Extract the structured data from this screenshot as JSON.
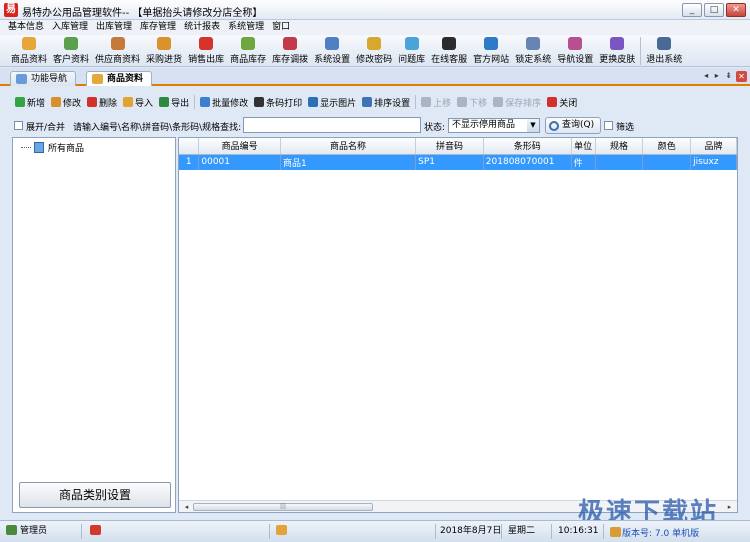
{
  "window": {
    "title": "易特办公用品管理软件-- 【单据抬头请修改分店全称】",
    "app_icon_glyph": "易",
    "minimize": "_",
    "restore": "□",
    "close": "✕"
  },
  "menu": [
    "基本信息",
    "入库管理",
    "出库管理",
    "库存管理",
    "统计报表",
    "系统管理",
    "窗口"
  ],
  "toolbar": [
    {
      "label": "商品资料",
      "icon": "box-icon",
      "color": "#e8a53a"
    },
    {
      "label": "客户资料",
      "icon": "users-icon",
      "color": "#5aa04e"
    },
    {
      "label": "供应商资料",
      "icon": "supplier-icon",
      "color": "#c57a3c"
    },
    {
      "label": "采购进货",
      "icon": "truck-icon",
      "color": "#d9922c"
    },
    {
      "label": "销售出库",
      "icon": "cart-icon",
      "color": "#d8332b"
    },
    {
      "label": "商品库存",
      "icon": "stock-icon",
      "color": "#6da83f"
    },
    {
      "label": "库存调拨",
      "icon": "transfer-icon",
      "color": "#c23a4a"
    },
    {
      "label": "系统设置",
      "icon": "settings-icon",
      "color": "#4f7fc4"
    },
    {
      "label": "修改密码",
      "icon": "key-icon",
      "color": "#d7a72e"
    },
    {
      "label": "问题库",
      "icon": "question-icon",
      "color": "#4aa3d9"
    },
    {
      "label": "在线客服",
      "icon": "qq-icon",
      "color": "#2b2b2b"
    },
    {
      "label": "官方网站",
      "icon": "ie-icon",
      "color": "#2f79c9"
    },
    {
      "label": "锁定系统",
      "icon": "lock-icon",
      "color": "#6785b3"
    },
    {
      "label": "导航设置",
      "icon": "navigation-icon",
      "color": "#b84f8f"
    },
    {
      "label": "更换皮肤",
      "icon": "skin-icon",
      "color": "#7b55c2"
    },
    {
      "label": "退出系统",
      "icon": "exit-icon",
      "color": "#4a6a96"
    }
  ],
  "tabs": [
    {
      "label": "功能导航",
      "icon": "navigation-icon",
      "color": "#6a9bd8"
    },
    {
      "label": "商品资料",
      "icon": "goods-icon",
      "color": "#e3a93b"
    }
  ],
  "tab_nav": "◂ ▸ ⇟",
  "tab_close": "✕",
  "actions": [
    {
      "label": "新增",
      "icon": "add-icon",
      "color": "#34a342",
      "enabled": true
    },
    {
      "label": "修改",
      "icon": "edit-icon",
      "color": "#d98f2a",
      "enabled": true
    },
    {
      "label": "删除",
      "icon": "delete-icon",
      "color": "#d2312a",
      "enabled": true
    },
    {
      "label": "导入",
      "icon": "import-icon",
      "color": "#e0a42f",
      "enabled": true
    },
    {
      "label": "导出",
      "icon": "export-icon",
      "color": "#2e8b3d",
      "enabled": true
    },
    {
      "label": "批量修改",
      "icon": "batch-edit-icon",
      "color": "#3c7fd0",
      "enabled": true
    },
    {
      "label": "条码打印",
      "icon": "barcode-icon",
      "color": "#333333",
      "enabled": true
    },
    {
      "label": "显示图片",
      "icon": "picture-icon",
      "color": "#2f6fb8",
      "enabled": true
    },
    {
      "label": "排序设置",
      "icon": "sort-icon",
      "color": "#3d73b5",
      "enabled": true
    },
    {
      "label": "上移",
      "icon": "move-up-icon",
      "color": "#a9b5c4",
      "enabled": false
    },
    {
      "label": "下移",
      "icon": "move-down-icon",
      "color": "#a9b5c4",
      "enabled": false
    },
    {
      "label": "保存排序",
      "icon": "save-icon",
      "color": "#a9b5c4",
      "enabled": false
    },
    {
      "label": "关闭",
      "icon": "close-icon",
      "color": "#d2312a",
      "enabled": true
    }
  ],
  "search": {
    "expand_label": "展开/合并",
    "prompt": "请输入编号\\名称\\拼音码\\条形码\\规格查找:",
    "value": "",
    "status_label": "状态:",
    "status_value": "不显示停用商品",
    "query_label": "查询(Q)",
    "filter_label": "筛选"
  },
  "tree": {
    "root": "所有商品",
    "category_button": "商品类别设置"
  },
  "grid": {
    "columns": [
      "",
      "商品编号",
      "商品名称",
      "拼音码",
      "条形码",
      "单位",
      "规格",
      "颜色",
      "品牌"
    ],
    "rows": [
      [
        "1",
        "00001",
        "商品1",
        "SP1",
        "201808070001",
        "件",
        "",
        "",
        "jisuxz"
      ]
    ],
    "scroll_left": "◂",
    "scroll_right": "▸",
    "thumb_grip": "|||"
  },
  "status": {
    "user": "管理员",
    "date": "2018年8月7日",
    "weekday": "星期二",
    "time": "10:16:31",
    "version": "版本号: 7.0 单机版"
  },
  "watermark": "极速下载站"
}
